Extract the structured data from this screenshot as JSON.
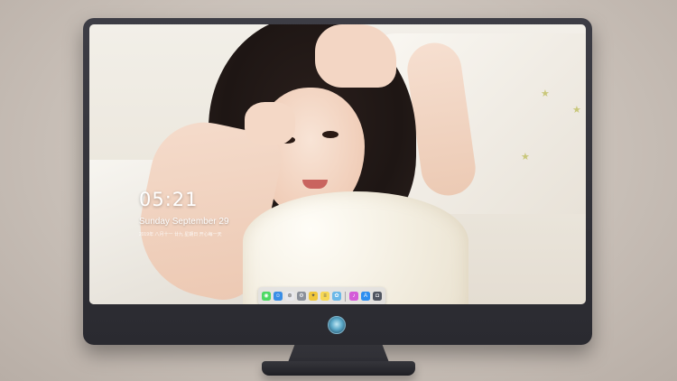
{
  "lock_screen": {
    "time": "05:21",
    "date": "Sunday September 29",
    "subtext": "2019年 八月十一 廿九 星期日  开心每一天"
  },
  "dock": {
    "apps": [
      {
        "name": "messages-icon",
        "glyph": "◉",
        "color": "#4cd964"
      },
      {
        "name": "finder-icon",
        "glyph": "☺",
        "color": "#3a8ee6"
      },
      {
        "name": "safari-icon",
        "glyph": "⊛",
        "color": "#e8e8ec"
      },
      {
        "name": "system-preferences-icon",
        "glyph": "⚙",
        "color": "#8a8f99"
      },
      {
        "name": "video-editor-icon",
        "glyph": "✦",
        "color": "#f0c73c"
      },
      {
        "name": "notes-icon",
        "glyph": "≡",
        "color": "#f7d854"
      },
      {
        "name": "photos-icon",
        "glyph": "✿",
        "color": "#6bb8e8"
      },
      {
        "name": "itunes-icon",
        "glyph": "♪",
        "color": "#d45ad8"
      },
      {
        "name": "app-store-icon",
        "glyph": "A",
        "color": "#2d8ef0"
      },
      {
        "name": "camera-icon",
        "glyph": "◘",
        "color": "#505560"
      }
    ]
  }
}
